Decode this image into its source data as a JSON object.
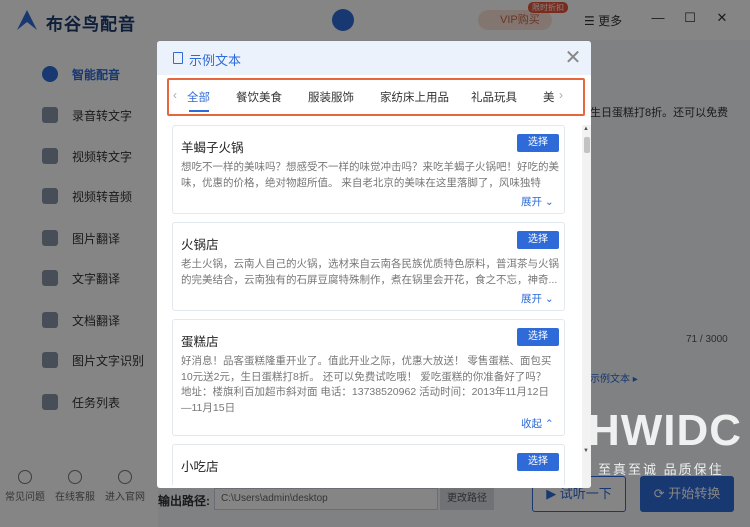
{
  "app": {
    "title": "布谷鸟配音"
  },
  "header": {
    "vip_label": "VIP购买",
    "vip_badge": "限时折扣",
    "more_label": "更多",
    "minimize": "—",
    "maximize": "☐",
    "close": "✕"
  },
  "sidebar": {
    "items": [
      {
        "label": "智能配音",
        "active": true
      },
      {
        "label": "录音转文字"
      },
      {
        "label": "视频转文字"
      },
      {
        "label": "视频转音频"
      },
      {
        "label": "图片翻译"
      },
      {
        "label": "文字翻译"
      },
      {
        "label": "文档翻译"
      },
      {
        "label": "图片文字识别"
      },
      {
        "label": "任务列表"
      }
    ],
    "bottom": [
      "常见问题",
      "在线客服",
      "进入官网"
    ]
  },
  "main": {
    "text_snippet": "生日蛋糕打8折。还可以免费",
    "counter": "71 / 3000",
    "sample_link": "示例文本 ▸",
    "output_label": "输出路径:",
    "output_path": "C:\\Users\\admin\\desktop",
    "change_path": "更改路径",
    "trial_button": "试听一下",
    "start_button": "开始转换"
  },
  "dialog": {
    "title": "示例文本",
    "close": "✕",
    "tabs": [
      "全部",
      "餐饮美食",
      "服装服饰",
      "家纺床上用品",
      "礼品玩具",
      "美"
    ],
    "active_tab": 0,
    "select_label": "选择",
    "cards": [
      {
        "title": "羊蝎子火锅",
        "desc": "想吃不一样的美味吗？想感受不一样的味觉冲击吗？来吃羊蝎子火锅吧！好吃的美味，优惠的价格，绝对物超所值。 来自老北京的美味在这里落脚了，风味独特的...",
        "toggle": "展开 ⌄"
      },
      {
        "title": "火锅店",
        "desc": "老土火锅，云南人自己的火锅，选材来自云南各民族优质特色原料，普洱茶与火锅的完美结合，云南独有的石屏豆腐特殊制作，煮在锅里会开花，食之不忘，神奇...",
        "toggle": "展开 ⌄"
      },
      {
        "title": "蛋糕店",
        "desc": "好消息！品客蛋糕隆重开业了。值此开业之际，优惠大放送！ 零售蛋糕、面包买10元送2元，生日蛋糕打8折。 还可以免费试吃哦！ 爱吃蛋糕的你准备好了吗？ 地址：楼旗利百加超市斜对面 电话：13738520962 活动时间：2013年11月12日—11月15日",
        "toggle": "收起 ⌃"
      },
      {
        "title": "小吃店",
        "desc": "",
        "toggle": ""
      }
    ]
  },
  "watermark": {
    "main": "HWIDC",
    "sub": "至真至诚 品质保住"
  },
  "colors": {
    "accent": "#2f6bd8",
    "highlight_border": "#e8663d",
    "vip": "#c56a47"
  }
}
